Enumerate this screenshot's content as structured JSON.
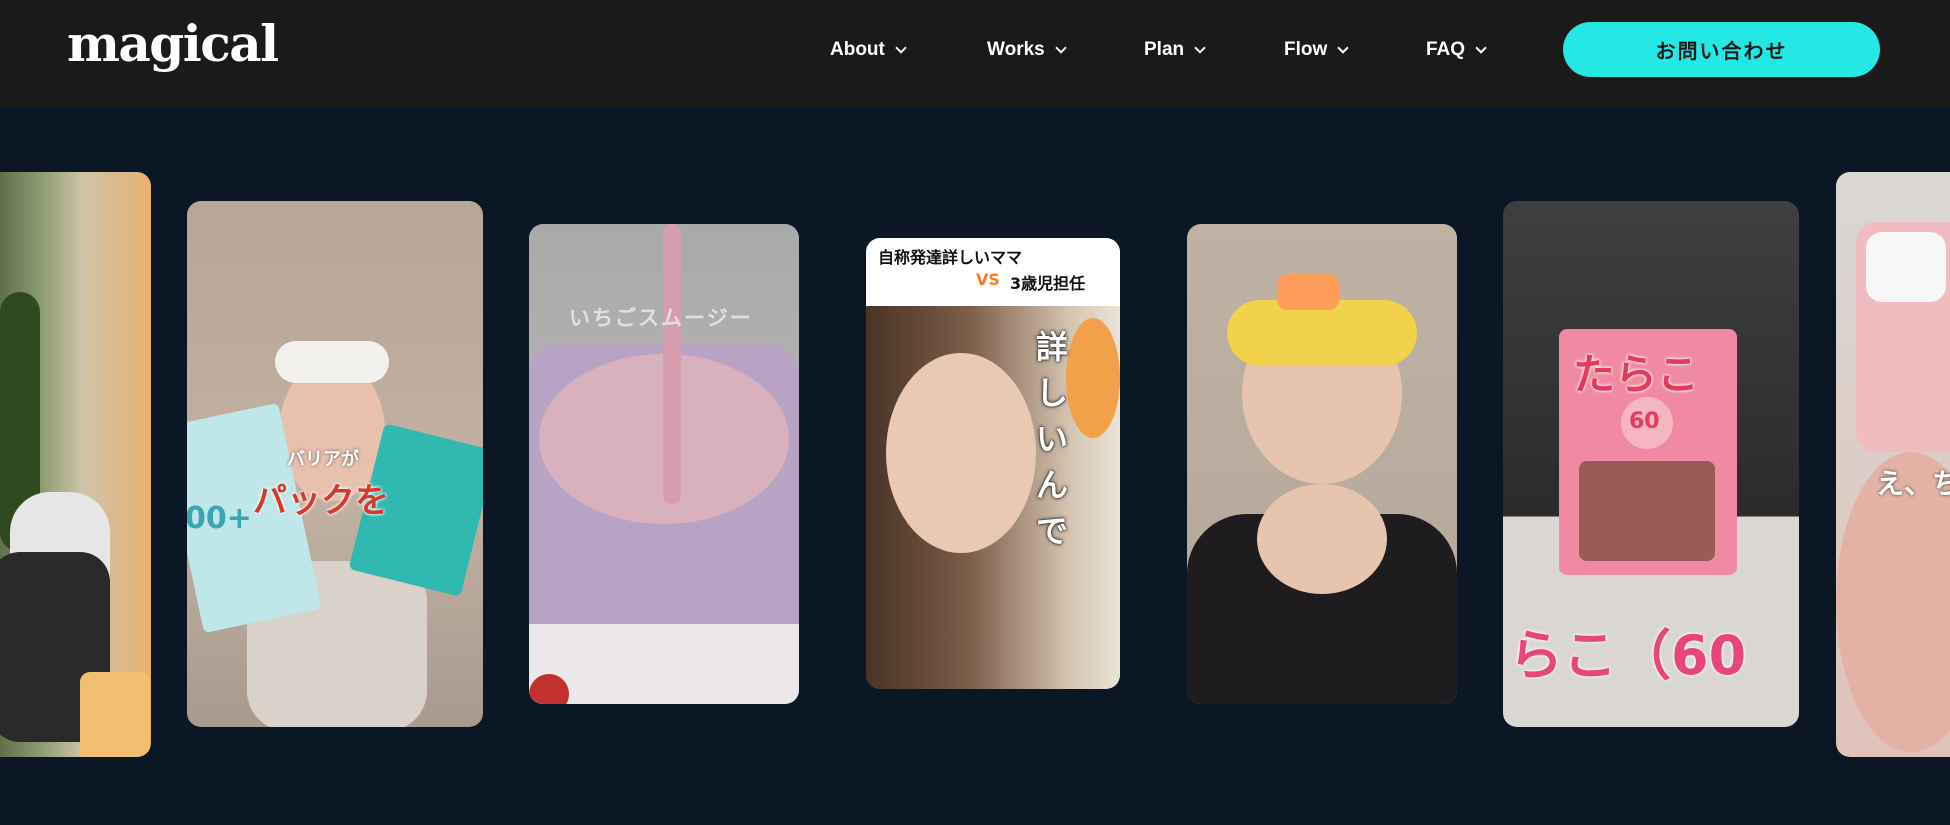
{
  "brand": {
    "logo": "magical"
  },
  "nav": {
    "items": [
      {
        "label": "About"
      },
      {
        "label": "Works"
      },
      {
        "label": "Plan"
      },
      {
        "label": "Flow"
      },
      {
        "label": "FAQ"
      }
    ],
    "cta_label": "お問い合わせ"
  },
  "cards": {
    "c1": {
      "caption_small": "バリアが",
      "caption_large": "パックを",
      "pack_text": "00+"
    },
    "c2": {
      "caption": "いちごスムージー"
    },
    "c3": {
      "caption_line1": "自称発達詳しいママ",
      "caption_vs": "VS",
      "caption_line2": "3歳児担任",
      "vertical_caption": "詳しいんで"
    },
    "c5": {
      "package_text": "たらこ",
      "package_badge": "60",
      "bottom_caption": "らこ（60"
    },
    "c6": {
      "caption": "え、ち"
    }
  },
  "colors": {
    "accent": "#24e8e4",
    "header_bg": "#1a1a1a",
    "page_bg": "#0b1724"
  }
}
